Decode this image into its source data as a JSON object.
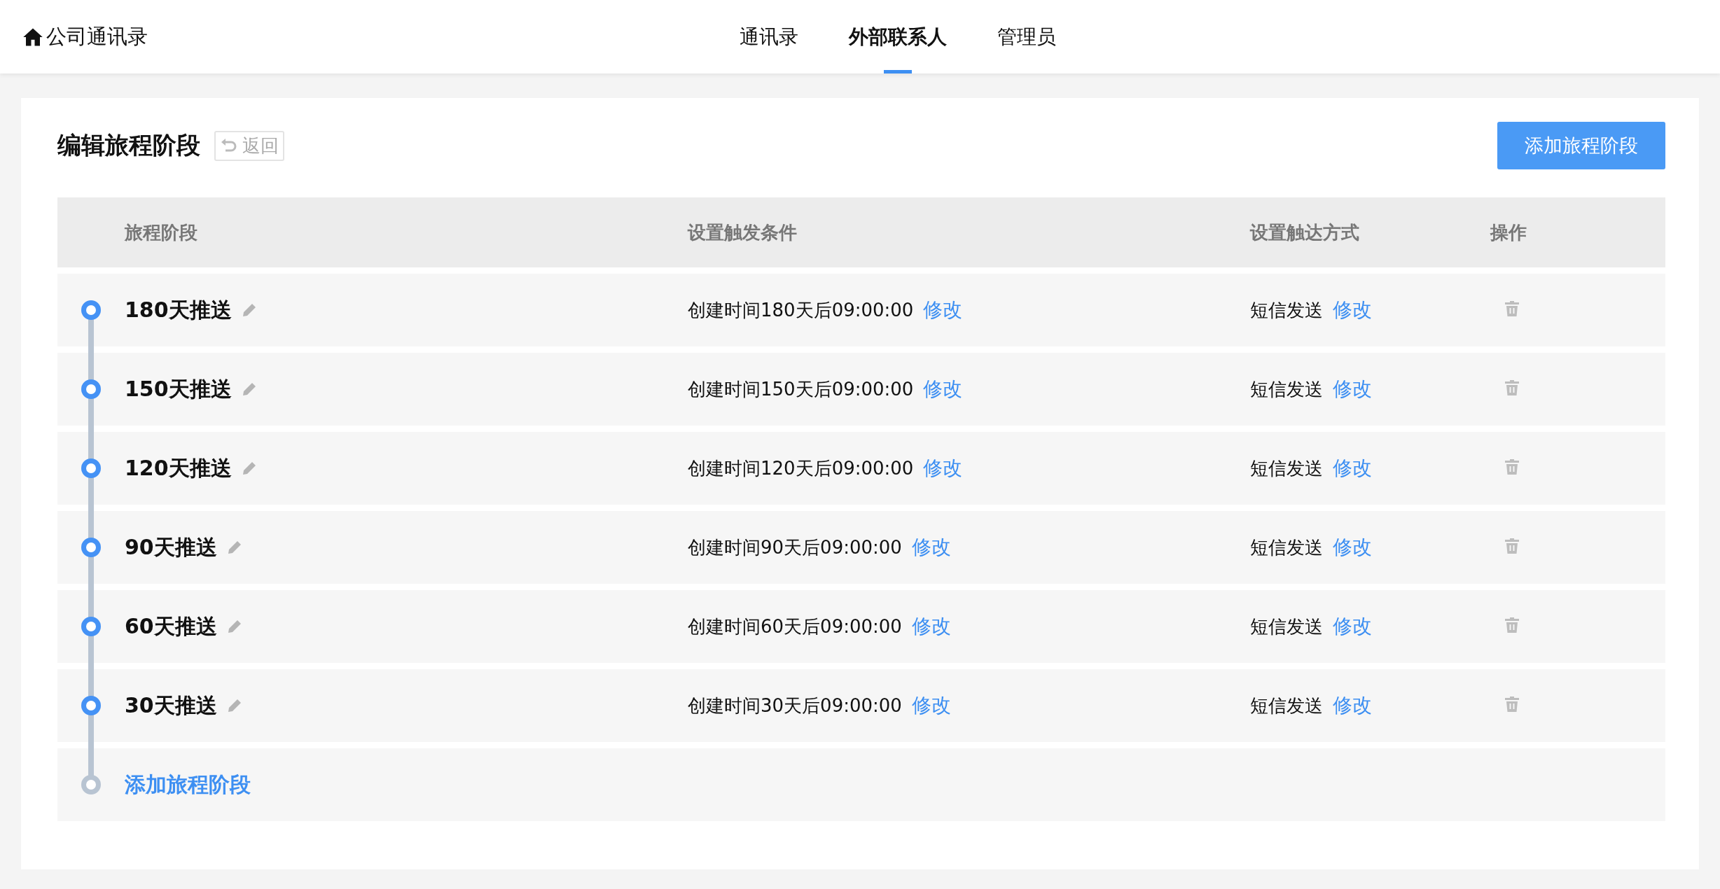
{
  "header": {
    "title": "公司通讯录",
    "nav": [
      {
        "label": "通讯录",
        "selected": false
      },
      {
        "label": "外部联系人",
        "selected": true
      },
      {
        "label": "管理员",
        "selected": false
      }
    ]
  },
  "page": {
    "title": "编辑旅程阶段",
    "back": "返回",
    "add_button": "添加旅程阶段"
  },
  "table": {
    "columns": [
      "旅程阶段",
      "设置触发条件",
      "设置触达方式",
      "操作"
    ],
    "rows": [
      {
        "stage": "180天推送",
        "trigger": "创建时间180天后09:00:00",
        "trigger_action": "修改",
        "method": "短信发送",
        "method_action": "修改"
      },
      {
        "stage": "150天推送",
        "trigger": "创建时间150天后09:00:00",
        "trigger_action": "修改",
        "method": "短信发送",
        "method_action": "修改"
      },
      {
        "stage": "120天推送",
        "trigger": "创建时间120天后09:00:00",
        "trigger_action": "修改",
        "method": "短信发送",
        "method_action": "修改"
      },
      {
        "stage": "90天推送",
        "trigger": "创建时间90天后09:00:00",
        "trigger_action": "修改",
        "method": "短信发送",
        "method_action": "修改"
      },
      {
        "stage": "60天推送",
        "trigger": "创建时间60天后09:00:00",
        "trigger_action": "修改",
        "method": "短信发送",
        "method_action": "修改"
      },
      {
        "stage": "30天推送",
        "trigger": "创建时间30天后09:00:00",
        "trigger_action": "修改",
        "method": "短信发送",
        "method_action": "修改"
      }
    ],
    "add_row": "添加旅程阶段"
  }
}
